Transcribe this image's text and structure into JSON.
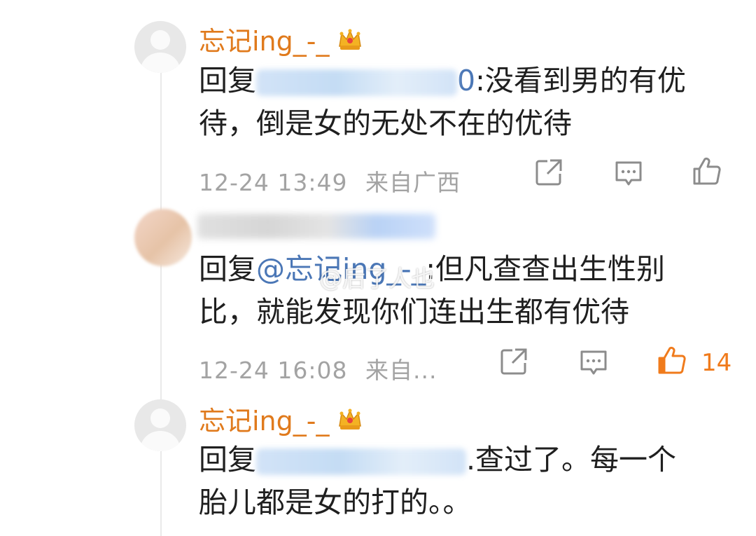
{
  "comments": [
    {
      "username": "忘记ing_-_",
      "reply_prefix": "回复",
      "reply_mention_visible_tail": "0",
      "text_line1": ":没看到男的有优",
      "text_line2": "待，倒是女的无处不在的优待",
      "time": "12-24 13:49",
      "location": "来自广西"
    },
    {
      "reply_prefix": "回复",
      "reply_mention": "@忘记ing_-_",
      "text_line1": ":但凡查查出生性别",
      "text_line2": "比，就能发现你们连出生都有优待",
      "time": "12-24 16:08",
      "location": "来自...",
      "like_count": "14"
    },
    {
      "username": "忘记ing_-_",
      "reply_prefix": "回复",
      "text_line1": ".查过了。每一个",
      "text_line2": "胎儿都是女的打的。。"
    }
  ],
  "watermark": "@后了人也",
  "icons": {
    "share": "share-icon",
    "comment": "comment-icon",
    "like": "thumb-up-icon",
    "crown": "crown-badge-icon"
  },
  "colors": {
    "username": "#e07a1c",
    "mention": "#4b77b6",
    "meta": "#a3a3a3",
    "like_active": "#f07b1c",
    "icon": "#8c8c8c"
  }
}
